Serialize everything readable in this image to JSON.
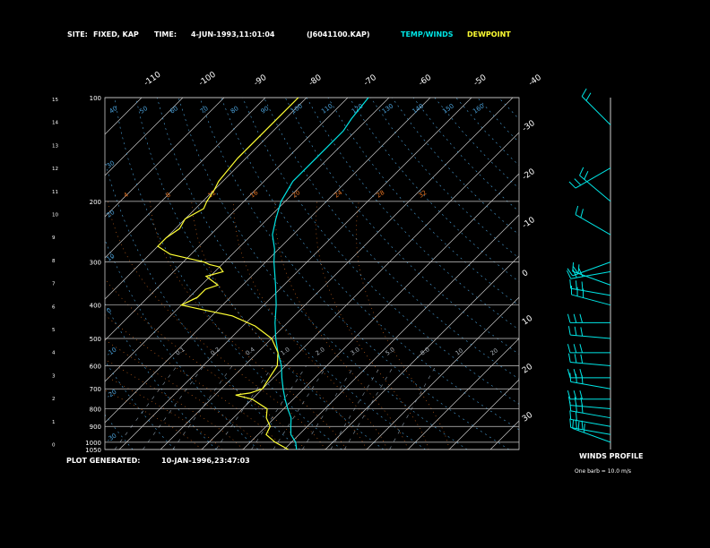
{
  "header": {
    "site_label": "SITE:",
    "site_value": "FIXED, KAP",
    "time_label": "TIME:",
    "time_value": "4-JUN-1993,11:01:04",
    "file": "(J6041100.KAP)",
    "legend_temp": "TEMP/WINDS",
    "legend_dew": "DEWPOINT"
  },
  "footer": {
    "generated_label": "PLOT GENERATED:",
    "generated_value": "10-JAN-1996,23:47:03",
    "winds_title": "WINDS PROFILE",
    "barb_note": "One barb = 10.0 m/s"
  },
  "colors": {
    "background": "#000000",
    "grid": "#c8c8c8",
    "temperature": "#00e5e5",
    "dewpoint": "#ffff33",
    "mixing_ratio": "#e07020",
    "dry_adiabat": "#4aa0d8",
    "text": "#ffffff"
  },
  "chart_data": {
    "type": "line",
    "title": "",
    "pressure_levels": [
      100,
      200,
      300,
      400,
      500,
      600,
      700,
      800,
      900,
      1000,
      1050
    ],
    "km_scale": [
      "15",
      "14",
      "13",
      "12",
      "11",
      "10",
      "9",
      "8",
      "7",
      "6",
      "5",
      "4",
      "3",
      "2",
      "1",
      "0"
    ],
    "skew_top_labels": [
      "-110",
      "-100",
      "-90",
      "-80",
      "-70",
      "-60",
      "-50",
      "-40"
    ],
    "right_labels": [
      "-30",
      "-20",
      "-10",
      "0",
      "10",
      "20",
      "30"
    ],
    "theta_top_labels": [
      "40",
      "50",
      "60",
      "70",
      "80",
      "90",
      "100",
      "110",
      "120",
      "130",
      "140",
      "150",
      "160"
    ],
    "theta_left_labels": [
      "30",
      "20",
      "10",
      "0",
      "-10",
      "-20",
      "-30",
      "-35"
    ],
    "mixing_labels": [
      "4",
      "8",
      "12",
      "16",
      "20",
      "24",
      "28",
      "32"
    ],
    "mixing_ratio_labels": [
      "0.1",
      "0.2",
      "0.4",
      "1.0",
      "2.0",
      "3.0",
      "5.0",
      "8.0",
      "10",
      "20"
    ],
    "series": [
      {
        "key": "temperature",
        "values": [
          [
            1050,
            3
          ],
          [
            1000,
            1
          ],
          [
            950,
            -2
          ],
          [
            900,
            -4
          ],
          [
            850,
            -6
          ],
          [
            800,
            -9
          ],
          [
            750,
            -12
          ],
          [
            700,
            -15
          ],
          [
            650,
            -18
          ],
          [
            600,
            -21
          ],
          [
            550,
            -25
          ],
          [
            500,
            -29
          ],
          [
            450,
            -33
          ],
          [
            400,
            -37
          ],
          [
            350,
            -42
          ],
          [
            300,
            -48
          ],
          [
            275,
            -51
          ],
          [
            250,
            -55
          ],
          [
            225,
            -58
          ],
          [
            200,
            -61
          ],
          [
            175,
            -63
          ],
          [
            150,
            -63
          ],
          [
            125,
            -63
          ],
          [
            115,
            -64
          ],
          [
            100,
            -65
          ]
        ]
      },
      {
        "key": "dewpoint",
        "values": [
          [
            1050,
            1
          ],
          [
            1000,
            -4
          ],
          [
            950,
            -8
          ],
          [
            900,
            -9
          ],
          [
            850,
            -12
          ],
          [
            800,
            -14
          ],
          [
            750,
            -20
          ],
          [
            730,
            -25
          ],
          [
            720,
            -22
          ],
          [
            700,
            -20
          ],
          [
            650,
            -21
          ],
          [
            600,
            -22
          ],
          [
            550,
            -25
          ],
          [
            500,
            -30
          ],
          [
            460,
            -37
          ],
          [
            430,
            -45
          ],
          [
            410,
            -55
          ],
          [
            400,
            -60
          ],
          [
            380,
            -58
          ],
          [
            360,
            -58
          ],
          [
            350,
            -56
          ],
          [
            330,
            -61
          ],
          [
            320,
            -58
          ],
          [
            310,
            -60
          ],
          [
            305,
            -63
          ],
          [
            300,
            -65
          ],
          [
            285,
            -75
          ],
          [
            270,
            -80
          ],
          [
            255,
            -80
          ],
          [
            240,
            -79
          ],
          [
            225,
            -80
          ],
          [
            210,
            -78
          ],
          [
            200,
            -79
          ],
          [
            185,
            -80
          ],
          [
            175,
            -81
          ],
          [
            150,
            -82
          ],
          [
            125,
            -82
          ],
          [
            100,
            -82
          ]
        ]
      }
    ]
  },
  "winds": {
    "note": "",
    "barbs": [
      {
        "p": 1000,
        "dir": 290,
        "spd": 25
      },
      {
        "p": 950,
        "dir": 280,
        "spd": 25
      },
      {
        "p": 900,
        "dir": 280,
        "spd": 15
      },
      {
        "p": 850,
        "dir": 280,
        "spd": 25
      },
      {
        "p": 800,
        "dir": 275,
        "spd": 25
      },
      {
        "p": 750,
        "dir": 270,
        "spd": 25
      },
      {
        "p": 700,
        "dir": 280,
        "spd": 25
      },
      {
        "p": 650,
        "dir": 270,
        "spd": 30
      },
      {
        "p": 600,
        "dir": 275,
        "spd": 25
      },
      {
        "p": 550,
        "dir": 270,
        "spd": 25
      },
      {
        "p": 500,
        "dir": 275,
        "spd": 25
      },
      {
        "p": 450,
        "dir": 270,
        "spd": 25
      },
      {
        "p": 400,
        "dir": 285,
        "spd": 25
      },
      {
        "p": 375,
        "dir": 280,
        "spd": 25
      },
      {
        "p": 350,
        "dir": 290,
        "spd": 15
      },
      {
        "p": 320,
        "dir": 260,
        "spd": 25
      },
      {
        "p": 300,
        "dir": 250,
        "spd": 15
      },
      {
        "p": 250,
        "dir": 300,
        "spd": 15
      },
      {
        "p": 200,
        "dir": 310,
        "spd": 15
      },
      {
        "p": 160,
        "dir": 240,
        "spd": 15
      },
      {
        "p": 120,
        "dir": 315,
        "spd": 15
      }
    ]
  }
}
